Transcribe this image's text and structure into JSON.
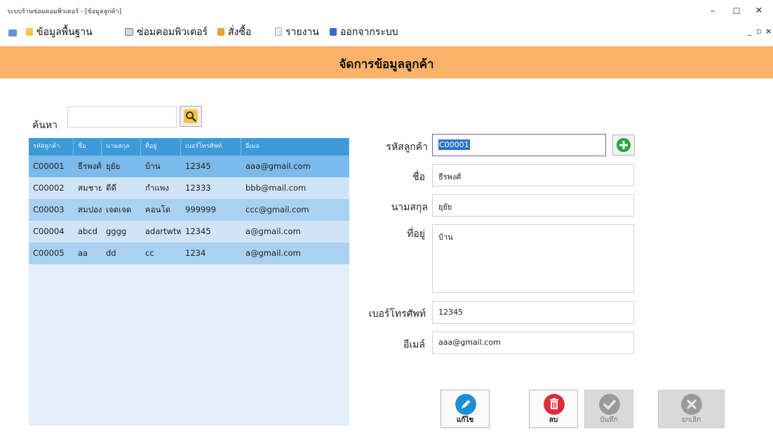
{
  "window": {
    "title": "ระบบร้านซ่อมคอมพิวเตอร์ - [ข้อมูลลูกค้า]",
    "controls": [
      "–",
      "☐",
      "✕"
    ]
  },
  "menu": {
    "items": [
      "ข้อมูลพื้นฐาน",
      "ซ่อมคอมพิวเตอร์",
      "สั่งซื้อ",
      "รายงาน",
      "ออกจากระบบ"
    ],
    "mdi_controls": [
      "_",
      "▫",
      "×"
    ]
  },
  "header": {
    "title": "จัดการข้อมูลลูกค้า",
    "color": "#fbb36a"
  },
  "search": {
    "label": "ค้นหา",
    "value": "",
    "icon": "magnifier-icon"
  },
  "table": {
    "columns": [
      "รหัสลูกค้า",
      "ชื่อ",
      "นามสกุล",
      "ที่อยู่",
      "เบอร์โทรศัพท์",
      "อีเมล"
    ],
    "rows": [
      [
        "C00001",
        "ธีรพงศ์",
        "ยุยัย",
        "บ้าน",
        "12345",
        "aaa@gmail.com"
      ],
      [
        "C00002",
        "สมชาย",
        "ดีดี",
        "กำแพง",
        "12333",
        "bbb@mail.com"
      ],
      [
        "C00003",
        "สมปอง",
        "เจดเจด",
        "คอนโด",
        "999999",
        "ccc@gmail.com"
      ],
      [
        "C00004",
        "abcd",
        "gggg",
        "adartwtwt4",
        "12345",
        "a@gmail.com"
      ],
      [
        "C00005",
        "aa",
        "dd",
        "cc",
        "1234",
        "a@gmail.com"
      ]
    ],
    "selected_row": 0
  },
  "form": {
    "customer_id": {
      "label": "รหัสลูกค้า",
      "value": "C00001"
    },
    "first_name": {
      "label": "ชื่อ",
      "value": "ธีรพงศ์"
    },
    "last_name": {
      "label": "นามสกุล",
      "value": "ยุยัย"
    },
    "address": {
      "label": "ที่อยู่",
      "value": "บ้าน"
    },
    "phone": {
      "label": "เบอร์โทรศัพท์",
      "value": "12345"
    },
    "email": {
      "label": "อีเมล์",
      "value": "aaa@gmail.com"
    }
  },
  "buttons": {
    "edit": {
      "label": "แก้ไข",
      "icon": "pencil-icon",
      "color": "#1a8fd8"
    },
    "delete": {
      "label": "ลบ",
      "icon": "trash-icon",
      "color": "#e02a3a"
    },
    "save": {
      "label": "บันทึก",
      "icon": "check-icon",
      "color": "#9a9a9a"
    },
    "cancel": {
      "label": "ยกเลิก",
      "icon": "x-circle-icon",
      "color": "#9a9a9a"
    }
  }
}
